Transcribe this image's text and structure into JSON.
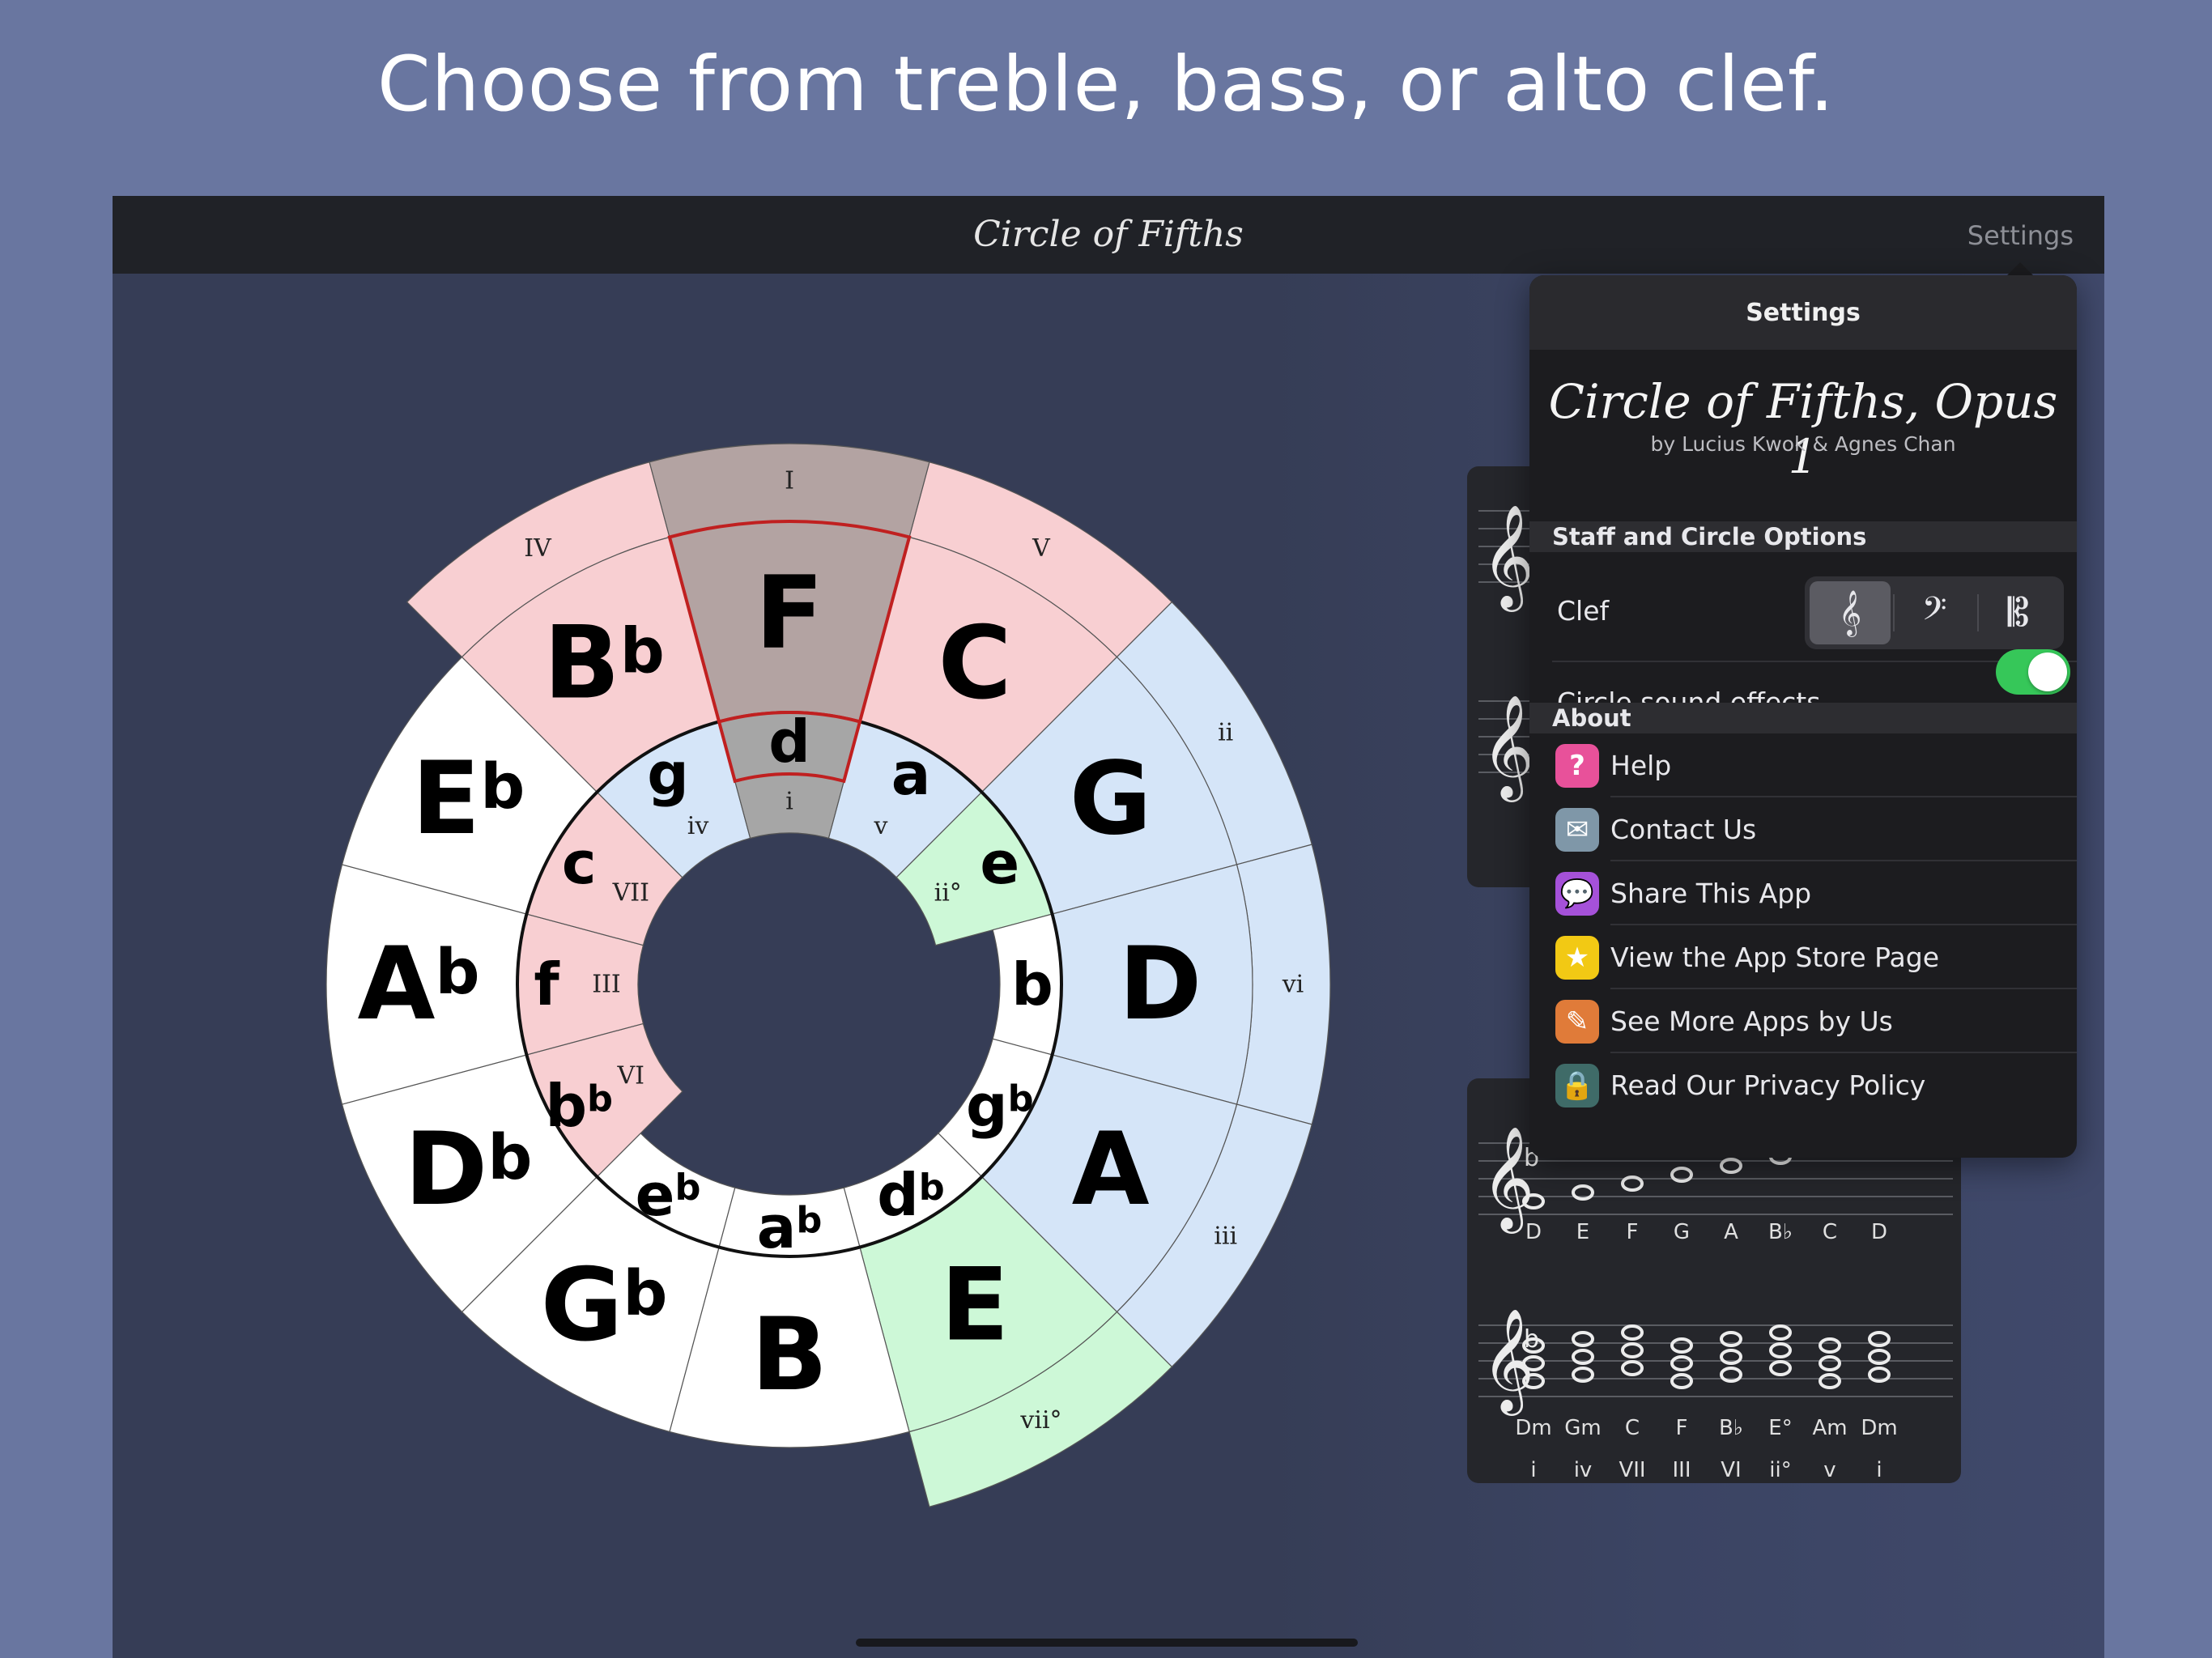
{
  "headline": "Choose from treble, bass, or alto clef.",
  "navbar": {
    "title": "Circle of Fifths",
    "settings_label": "Settings"
  },
  "circle": {
    "major_keys": [
      "C",
      "G",
      "D",
      "A",
      "E",
      "B",
      "Gb",
      "Db",
      "Ab",
      "Eb",
      "Bb",
      "F"
    ],
    "minor_keys": [
      "a",
      "e",
      "b",
      "gb",
      "db",
      "ab",
      "eb",
      "bb",
      "f",
      "c",
      "g",
      "d"
    ],
    "highlighted_key": "F",
    "highlighted_minor": "d",
    "outer_numerals": [
      "I",
      "V",
      "ii",
      "vi",
      "iii",
      "vii°",
      "IV"
    ],
    "inner_numerals": [
      "i",
      "v",
      "ii°",
      "VI",
      "III",
      "VII",
      "iv"
    ],
    "colors": {
      "tonic_region": "#f8cfd2",
      "selected": "#b3a3a2",
      "selected_minor": "#a6a6a6",
      "dominant_region": "#d5e5f8",
      "diminished": "#cdf8d7",
      "neutral": "#ffffff",
      "selected_outline": "#c02020"
    }
  },
  "staff": {
    "key_signature": "b",
    "scale_notes": [
      "D",
      "E",
      "F",
      "G",
      "A",
      "B♭",
      "C",
      "D"
    ],
    "chords": [
      "Dm",
      "Gm",
      "C",
      "F",
      "B♭",
      "E°",
      "Am",
      "Dm"
    ],
    "numerals": [
      "i",
      "iv",
      "VII",
      "III",
      "VI",
      "ii°",
      "v",
      "i"
    ]
  },
  "settings": {
    "header": "Settings",
    "app_name": "Circle of Fifths, Opus 1",
    "byline": "by Lucius Kwok & Agnes Chan",
    "staff_section": "Staff and Circle Options",
    "clef_label": "Clef",
    "clef_options": [
      "𝄞",
      "𝄢",
      "𝄡"
    ],
    "clef_selected": "treble",
    "sound_label": "Circle sound effects",
    "sound_on": true,
    "about_section": "About",
    "about_items": [
      {
        "label": "Help",
        "icon": "help-icon",
        "glyph": "?",
        "color": "#e8519a"
      },
      {
        "label": "Contact Us",
        "icon": "envelope-icon",
        "glyph": "✉",
        "color": "#7f97a8"
      },
      {
        "label": "Share This App",
        "icon": "speech-bubble-icon",
        "glyph": "💬",
        "color": "#a551d9"
      },
      {
        "label": "View the App Store Page",
        "icon": "star-icon",
        "glyph": "★",
        "color": "#f2c914"
      },
      {
        "label": "See More Apps by Us",
        "icon": "compass-icon",
        "glyph": "✎",
        "color": "#e07b39"
      },
      {
        "label": "Read Our Privacy Policy",
        "icon": "lock-icon",
        "glyph": "🔒",
        "color": "#3f6b68"
      }
    ]
  }
}
